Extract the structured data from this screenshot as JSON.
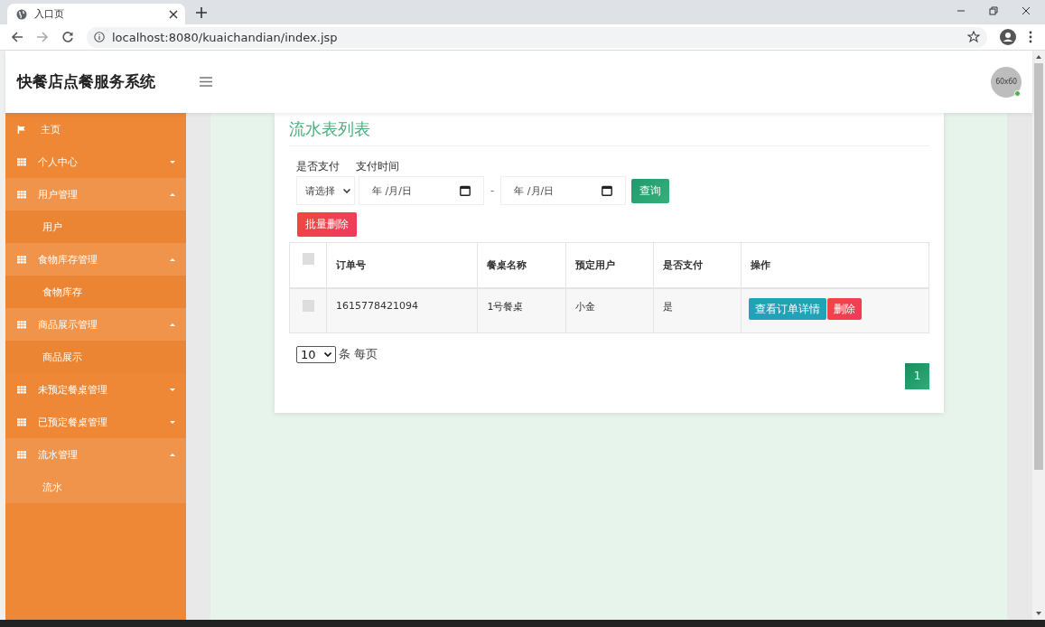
{
  "browser": {
    "tab_title": "入口页",
    "url": "localhost:8080/kuaichandian/index.jsp"
  },
  "header": {
    "title": "快餐店点餐服务系统",
    "avatar_text": "60x60",
    "online": true
  },
  "sidebar": {
    "items": [
      {
        "label": "主页",
        "kind": "link"
      },
      {
        "label": "个人中心",
        "kind": "group",
        "expanded": false
      },
      {
        "label": "用户管理",
        "kind": "group",
        "expanded": true,
        "children": [
          {
            "label": "用户",
            "selected": false
          }
        ]
      },
      {
        "label": "食物库存管理",
        "kind": "group",
        "expanded": true,
        "children": [
          {
            "label": "食物库存",
            "selected": false
          }
        ]
      },
      {
        "label": "商品展示管理",
        "kind": "group",
        "expanded": true,
        "children": [
          {
            "label": "商品展示",
            "selected": false
          }
        ]
      },
      {
        "label": "未预定餐桌管理",
        "kind": "group",
        "expanded": false
      },
      {
        "label": "已预定餐桌管理",
        "kind": "group",
        "expanded": false
      },
      {
        "label": "流水管理",
        "kind": "group",
        "expanded": true,
        "children": [
          {
            "label": "流水",
            "selected": true
          }
        ]
      }
    ]
  },
  "card": {
    "title": "流水表列表",
    "filters": {
      "paid_label": "是否支付",
      "time_label": "支付时间",
      "paid_select": "请选择",
      "date_from_placeholder": "年 /月/日",
      "separator": "-",
      "date_to_placeholder": "年 /月/日",
      "search_button": "查询"
    },
    "batch_delete_button": "批量删除",
    "table": {
      "header_checked": false,
      "columns": [
        "订单号",
        "餐桌名称",
        "预定用户",
        "是否支付",
        "操作"
      ],
      "rows": [
        {
          "checked": false,
          "cells": [
            "1615778421094",
            "1号餐桌",
            "小金",
            "是"
          ],
          "actions": [
            {
              "label": "查看订单详情",
              "kind": "view"
            },
            {
              "label": "删除",
              "kind": "delete"
            }
          ]
        }
      ]
    },
    "page_size": "10",
    "page_size_label": "条 每页",
    "pages": [
      {
        "label": "1",
        "selected": true
      }
    ]
  }
}
